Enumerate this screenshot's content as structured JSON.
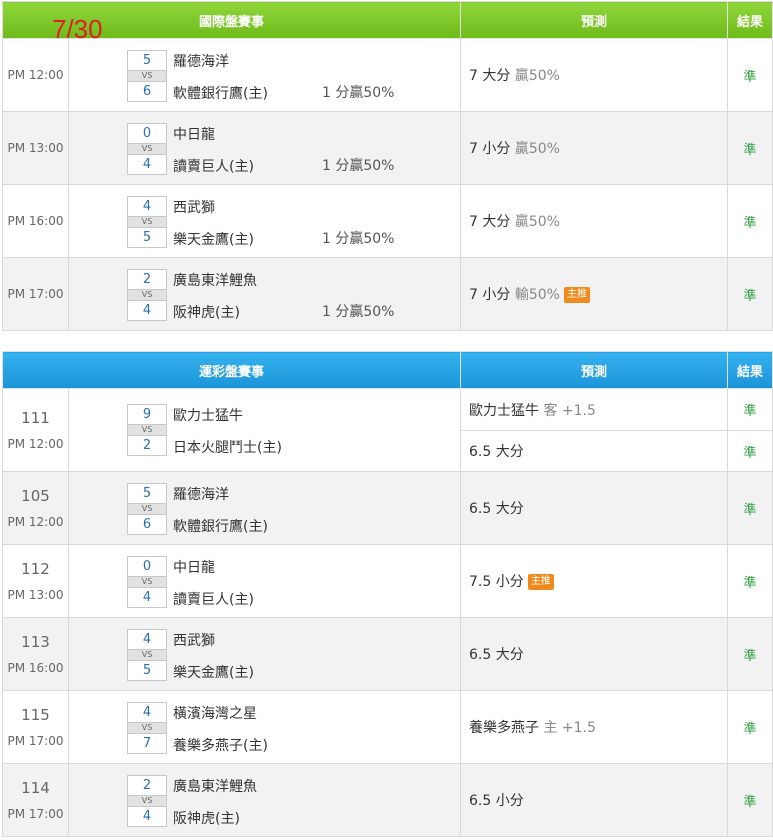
{
  "date": "7/30",
  "intl": {
    "headers": {
      "match": "國際盤賽事",
      "prediction": "預測",
      "result": "結果"
    },
    "rows": [
      {
        "time": "PM 12:00",
        "away_score": "5",
        "home_score": "6",
        "away": "羅德海洋",
        "home": "軟體銀行鷹(主)",
        "odds": "1 分贏50%",
        "pred_main": "7 大分",
        "pred_sub": "贏50%",
        "badge": "",
        "result": "準"
      },
      {
        "time": "PM 13:00",
        "away_score": "0",
        "home_score": "4",
        "away": "中日龍",
        "home": "讀賣巨人(主)",
        "odds": "1 分贏50%",
        "pred_main": "7 小分",
        "pred_sub": "贏50%",
        "badge": "",
        "result": "準"
      },
      {
        "time": "PM 16:00",
        "away_score": "4",
        "home_score": "5",
        "away": "西武獅",
        "home": "樂天金鷹(主)",
        "odds": "1 分贏50%",
        "pred_main": "7 大分",
        "pred_sub": "贏50%",
        "badge": "",
        "result": "準"
      },
      {
        "time": "PM 17:00",
        "away_score": "2",
        "home_score": "4",
        "away": "廣島東洋鯉魚",
        "home": "阪神虎(主)",
        "odds": "1 分贏50%",
        "pred_main": "7 小分",
        "pred_sub": "輸50%",
        "badge": "主推",
        "result": "準"
      }
    ]
  },
  "lottery": {
    "headers": {
      "match": "運彩盤賽事",
      "prediction": "預測",
      "result": "結果"
    },
    "vs_label": "VS",
    "rows": [
      {
        "id": "111",
        "time": "PM 12:00",
        "away_score": "9",
        "home_score": "2",
        "away": "歐力士猛牛",
        "home": "日本火腿鬥士(主)",
        "preds": [
          {
            "main": "歐力士猛牛",
            "sub": "客 +1.5",
            "badge": "",
            "result": "準"
          },
          {
            "main": "6.5 大分",
            "sub": "",
            "badge": "",
            "result": "準"
          }
        ]
      },
      {
        "id": "105",
        "time": "PM 12:00",
        "away_score": "5",
        "home_score": "6",
        "away": "羅德海洋",
        "home": "軟體銀行鷹(主)",
        "preds": [
          {
            "main": "6.5 大分",
            "sub": "",
            "badge": "",
            "result": "準"
          }
        ]
      },
      {
        "id": "112",
        "time": "PM 13:00",
        "away_score": "0",
        "home_score": "4",
        "away": "中日龍",
        "home": "讀賣巨人(主)",
        "preds": [
          {
            "main": "7.5 小分",
            "sub": "",
            "badge": "主推",
            "result": "準"
          }
        ]
      },
      {
        "id": "113",
        "time": "PM 16:00",
        "away_score": "4",
        "home_score": "5",
        "away": "西武獅",
        "home": "樂天金鷹(主)",
        "preds": [
          {
            "main": "6.5 大分",
            "sub": "",
            "badge": "",
            "result": "準"
          }
        ]
      },
      {
        "id": "115",
        "time": "PM 17:00",
        "away_score": "4",
        "home_score": "7",
        "away": "橫濱海灣之星",
        "home": "養樂多燕子(主)",
        "preds": [
          {
            "main": "養樂多燕子",
            "sub": "主 +1.5",
            "badge": "",
            "result": "準"
          }
        ]
      },
      {
        "id": "114",
        "time": "PM 17:00",
        "away_score": "2",
        "home_score": "4",
        "away": "廣島東洋鯉魚",
        "home": "阪神虎(主)",
        "preds": [
          {
            "main": "6.5 小分",
            "sub": "",
            "badge": "",
            "result": "準"
          }
        ]
      }
    ]
  }
}
